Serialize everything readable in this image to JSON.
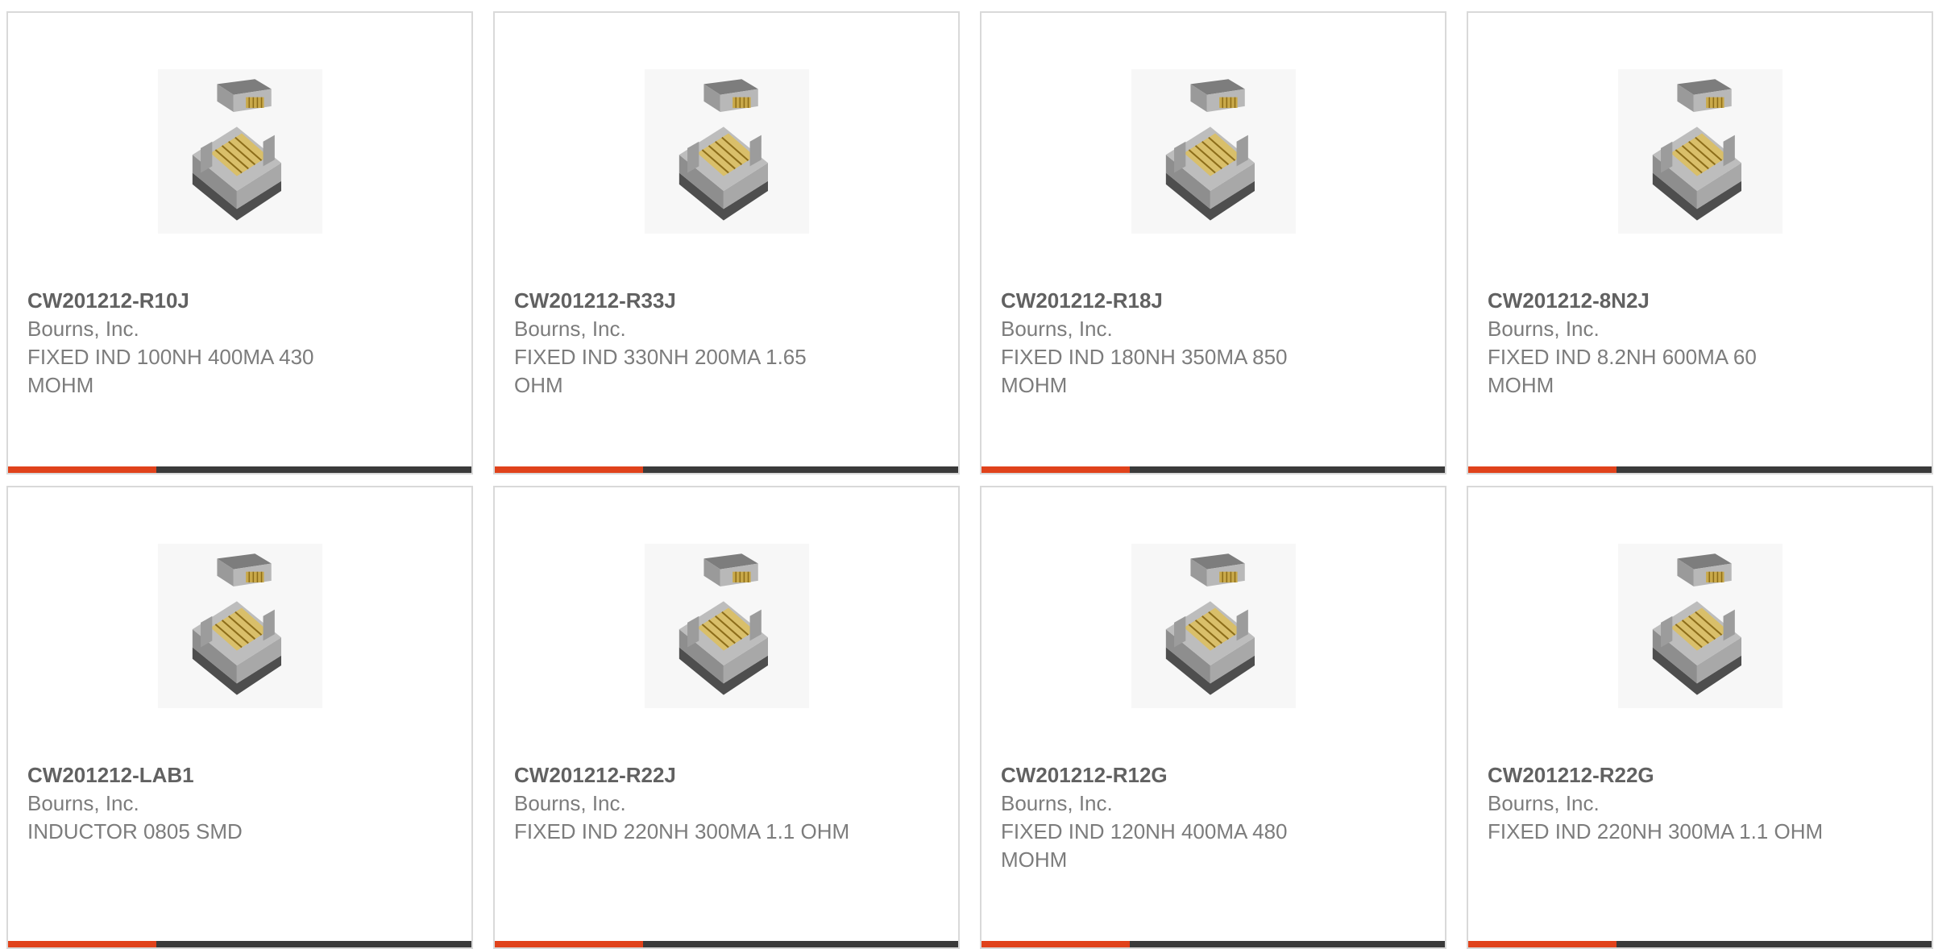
{
  "products": [
    {
      "part_number": "CW201212-R10J",
      "manufacturer": "Bourns, Inc.",
      "description": "FIXED IND 100NH 400MA 430 MOHM",
      "image_icon": "smd-inductor-icon",
      "progress": 0.32
    },
    {
      "part_number": "CW201212-R33J",
      "manufacturer": "Bourns, Inc.",
      "description": "FIXED IND 330NH 200MA 1.65 OHM",
      "image_icon": "smd-inductor-icon",
      "progress": 0.32
    },
    {
      "part_number": "CW201212-R18J",
      "manufacturer": "Bourns, Inc.",
      "description": "FIXED IND 180NH 350MA 850 MOHM",
      "image_icon": "smd-inductor-icon",
      "progress": 0.32
    },
    {
      "part_number": "CW201212-8N2J",
      "manufacturer": "Bourns, Inc.",
      "description": "FIXED IND 8.2NH 600MA 60 MOHM",
      "image_icon": "smd-inductor-icon",
      "progress": 0.32
    },
    {
      "part_number": "CW201212-LAB1",
      "manufacturer": "Bourns, Inc.",
      "description": "INDUCTOR 0805 SMD",
      "image_icon": "smd-inductor-icon",
      "progress": 0.32
    },
    {
      "part_number": "CW201212-R22J",
      "manufacturer": "Bourns, Inc.",
      "description": "FIXED IND 220NH 300MA 1.1 OHM",
      "image_icon": "smd-inductor-icon",
      "progress": 0.32
    },
    {
      "part_number": "CW201212-R12G",
      "manufacturer": "Bourns, Inc.",
      "description": "FIXED IND 120NH 400MA 480 MOHM",
      "image_icon": "smd-inductor-icon",
      "progress": 0.32
    },
    {
      "part_number": "CW201212-R22G",
      "manufacturer": "Bourns, Inc.",
      "description": "FIXED IND 220NH 300MA 1.1 OHM",
      "image_icon": "smd-inductor-icon",
      "progress": 0.32
    }
  ],
  "colors": {
    "accent": "#e0421b",
    "bar_track": "#3a3a3a",
    "card_border": "#d9d9d9",
    "part_text": "#616161",
    "secondary_text": "#7c7c7c"
  }
}
